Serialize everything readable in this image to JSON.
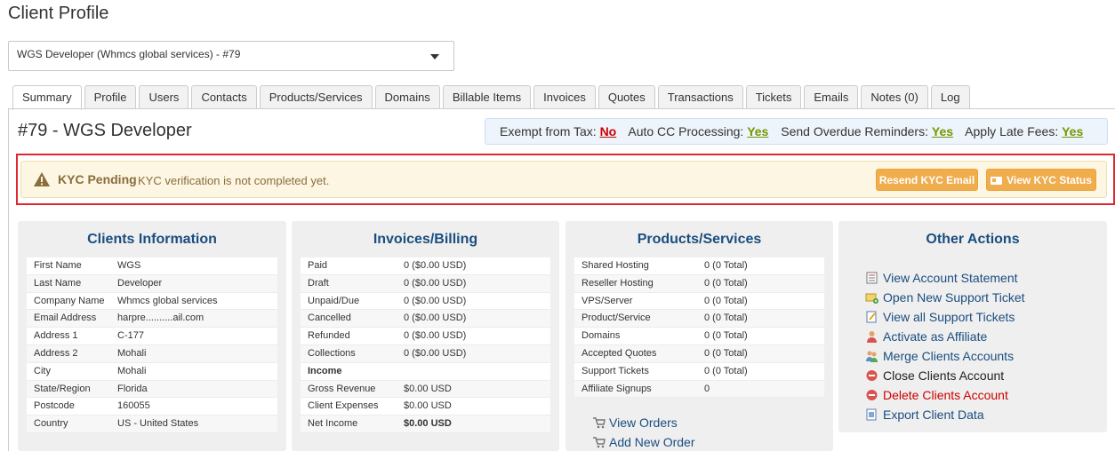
{
  "page": {
    "title": "Client Profile"
  },
  "client_select": {
    "value": "WGS Developer (Whmcs global services) - #79"
  },
  "tabs": [
    {
      "label": "Summary",
      "active": true
    },
    {
      "label": "Profile"
    },
    {
      "label": "Users"
    },
    {
      "label": "Contacts"
    },
    {
      "label": "Products/Services"
    },
    {
      "label": "Domains"
    },
    {
      "label": "Billable Items"
    },
    {
      "label": "Invoices"
    },
    {
      "label": "Quotes"
    },
    {
      "label": "Transactions"
    },
    {
      "label": "Tickets"
    },
    {
      "label": "Emails"
    },
    {
      "label": "Notes (0)"
    },
    {
      "label": "Log"
    }
  ],
  "client": {
    "heading": "#79 - WGS Developer"
  },
  "settings": {
    "exempt_tax_label": "Exempt from Tax:",
    "exempt_tax_value": "No",
    "auto_cc_label": "Auto CC Processing:",
    "auto_cc_value": "Yes",
    "overdue_label": "Send Overdue Reminders:",
    "overdue_value": "Yes",
    "late_fees_label": "Apply Late Fees:",
    "late_fees_value": "Yes"
  },
  "kyc": {
    "title": "KYC Pending",
    "message": "KYC verification is not completed yet.",
    "resend_label": "Resend KYC Email",
    "view_label": "View KYC Status"
  },
  "clients_info": {
    "title": "Clients Information",
    "rows": [
      {
        "label": "First Name",
        "value": "WGS"
      },
      {
        "label": "Last Name",
        "value": "Developer"
      },
      {
        "label": "Company Name",
        "value": "Whmcs global services"
      },
      {
        "label": "Email Address",
        "value": "harpre..........ail.com"
      },
      {
        "label": "Address 1",
        "value": "C-177"
      },
      {
        "label": "Address 2",
        "value": "Mohali"
      },
      {
        "label": "City",
        "value": "Mohali"
      },
      {
        "label": "State/Region",
        "value": "Florida"
      },
      {
        "label": "Postcode",
        "value": "160055"
      },
      {
        "label": "Country",
        "value": "US - United States"
      }
    ]
  },
  "invoices": {
    "title": "Invoices/Billing",
    "rows": [
      {
        "label": "Paid",
        "value": "0 ($0.00 USD)"
      },
      {
        "label": "Draft",
        "value": "0 ($0.00 USD)"
      },
      {
        "label": "Unpaid/Due",
        "value": "0 ($0.00 USD)"
      },
      {
        "label": "Cancelled",
        "value": "0 ($0.00 USD)"
      },
      {
        "label": "Refunded",
        "value": "0 ($0.00 USD)"
      },
      {
        "label": "Collections",
        "value": "0 ($0.00 USD)"
      },
      {
        "label": "Income",
        "value": ""
      },
      {
        "label": "Gross Revenue",
        "value": "$0.00 USD"
      },
      {
        "label": "Client Expenses",
        "value": "$0.00 USD"
      },
      {
        "label": "Net Income",
        "value": "$0.00 USD"
      }
    ]
  },
  "products": {
    "title": "Products/Services",
    "rows": [
      {
        "label": "Shared Hosting",
        "value": "0 (0 Total)"
      },
      {
        "label": "Reseller Hosting",
        "value": "0 (0 Total)"
      },
      {
        "label": "VPS/Server",
        "value": "0 (0 Total)"
      },
      {
        "label": "Product/Service",
        "value": "0 (0 Total)"
      },
      {
        "label": "Domains",
        "value": "0 (0 Total)"
      },
      {
        "label": "Accepted Quotes",
        "value": "0 (0 Total)"
      },
      {
        "label": "Support Tickets",
        "value": "0 (0 Total)"
      },
      {
        "label": "Affiliate Signups",
        "value": "0"
      }
    ],
    "view_orders": "View Orders",
    "add_new_order": "Add New Order"
  },
  "other_actions": {
    "title": "Other Actions",
    "items": [
      {
        "label": "View Account Statement",
        "icon": "statement-icon"
      },
      {
        "label": "Open New Support Ticket",
        "icon": "ticket-open-icon"
      },
      {
        "label": "View all Support Tickets",
        "icon": "tickets-list-icon"
      },
      {
        "label": "Activate as Affiliate",
        "icon": "user-icon"
      },
      {
        "label": "Merge Clients Accounts",
        "icon": "users-merge-icon"
      },
      {
        "label": "Close Clients Account",
        "icon": "close-account-icon"
      },
      {
        "label": "Delete Clients Account",
        "icon": "delete-account-icon"
      },
      {
        "label": "Export Client Data",
        "icon": "export-icon"
      }
    ]
  },
  "colors": {
    "accent_blue": "#1a4d80",
    "warning_orange": "#f0ad4e",
    "alert_bg": "#fcf6e3",
    "highlight_red": "#e0282e",
    "yes_green": "#779500",
    "no_red": "#cc0000"
  }
}
